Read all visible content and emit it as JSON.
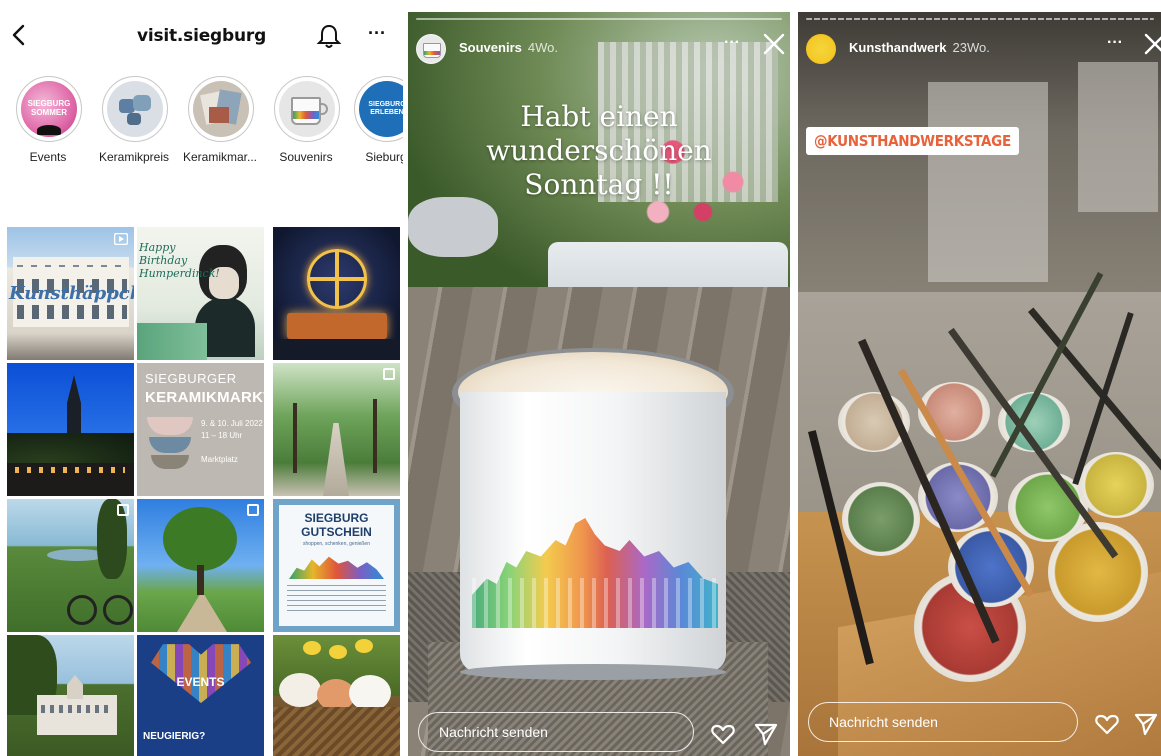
{
  "profile": {
    "username": "visit.siegburg",
    "highlights": [
      {
        "label": "Events"
      },
      {
        "label": "Keramikpreis"
      },
      {
        "label": "Keramikmar..."
      },
      {
        "label": "Souvenirs"
      },
      {
        "label": "Sieburg"
      }
    ],
    "highlight_badges": {
      "events": "SIEGBURG SOMMER",
      "sieburg": "SIEGBURG ERLEBEN"
    },
    "posts": [
      {
        "overlay": "Kunsthäppchen",
        "icon": "video-icon"
      },
      {
        "overlay": "Happy Birthday Humperdinck!"
      },
      {
        "overlay": ""
      },
      {
        "overlay": ""
      },
      {
        "overlay_title": "SIEGBURGER",
        "overlay_title2": "KERAMIKMARKT",
        "overlay_date": "9. & 10. Juli 2022",
        "overlay_time": "11 – 18 Uhr",
        "overlay_place": "Marktplatz"
      },
      {
        "overlay": "",
        "icon": "multi-icon"
      },
      {
        "overlay": "",
        "icon": "multi-icon"
      },
      {
        "overlay": "",
        "icon": "multi-icon"
      },
      {
        "overlay_title": "SIEGBURG",
        "overlay_title2": "GUTSCHEIN",
        "overlay_sub": "shoppen, schenken, genießen"
      },
      {
        "overlay": ""
      },
      {
        "overlay_title": "EVENTS",
        "overlay_sub": "NEUGIERIG?"
      },
      {
        "overlay": ""
      }
    ]
  },
  "story1": {
    "name": "Souvenirs",
    "time": "4Wo.",
    "caption_lines": [
      "Habt einen",
      "wunderschönen",
      "Sonntag !!"
    ],
    "reply_placeholder": "Nachricht senden"
  },
  "story2": {
    "name": "Kunsthandwerk",
    "time": "23Wo.",
    "tag": "@KUNSTHANDWERKSTAGE",
    "reply_placeholder": "Nachricht senden"
  },
  "colors": {
    "text": "#111111",
    "tag_orange": "#e8623a",
    "white": "#ffffff"
  }
}
